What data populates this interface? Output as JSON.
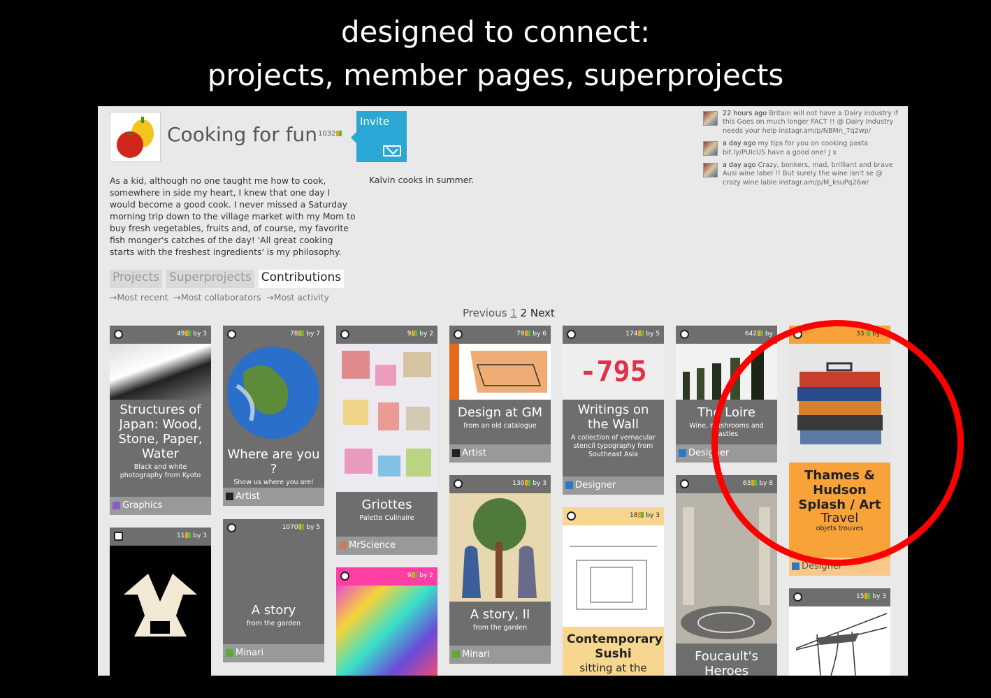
{
  "headline": {
    "line1": "designed to connect:",
    "line2": "projects, member pages, superprojects"
  },
  "project": {
    "title": "Cooking for fun",
    "count": "1032",
    "invite_label": "Invite",
    "description": "As a kid, although no one taught me how to cook, somewhere in side my heart, I knew that one day I would become a good cook. I never missed a Saturday morning trip down to the village market with my Mom to buy fresh vegetables, fruits and, of course, my favorite fish monger's catches of the day! 'All great cooking starts with the freshest ingredients' is my philosophy.",
    "description2": "Kalvin cooks in summer."
  },
  "tweets": [
    {
      "time": "22 hours ago",
      "text": "Britain will not have a Dairy industry if this Goes on much longer FACT !! @ Dairy Industry needs your help instagr.am/p/NBMn_Tq2wp/"
    },
    {
      "time": "a day ago",
      "text": "my tips for you on cooking pasta bit.ly/PUIcUS have a good one! J x"
    },
    {
      "time": "a day ago",
      "text": "Crazy, bonkers, mad, brilliant and brave Ausi wine label !! But surely the wine isn't se @ crazy wine lable instagr.am/p/M_ksuPq26w/"
    }
  ],
  "tabs": [
    "Projects",
    "Superprojects",
    "Contributions"
  ],
  "sorts": [
    "→Most recent",
    "→Most collaborators",
    "→Most activity"
  ],
  "pager": {
    "prev": "Previous",
    "p1": "1",
    "p2": "2",
    "next": "Next"
  },
  "cards": [
    {
      "count": "49",
      "by": "by 3",
      "title": "Structures of Japan: Wood, Stone, Paper, Water",
      "sub": "Black and white photography from Kyoto",
      "foot": "Graphics",
      "color": "#6e6e6e"
    },
    {
      "count": "11",
      "by": "by 3",
      "title": "",
      "sub": "",
      "foot": "",
      "color": "#000000"
    },
    {
      "count": "78",
      "by": "by 7",
      "title": "Where are you ?",
      "sub": "Show us where you are!",
      "foot": "Artist",
      "color": "#6e6e6e"
    },
    {
      "count": "1070",
      "by": "by 5",
      "title": "A story",
      "sub": "from the garden",
      "foot": "Minari",
      "color": "#6e6e6e"
    },
    {
      "count": "9",
      "by": "by 2",
      "title": "Griottes",
      "sub": "Palette Culinaire",
      "foot": "MrScience",
      "color": "#6e6e6e"
    },
    {
      "count": "9",
      "by": "by 2",
      "title": "",
      "sub": "",
      "foot": "",
      "color": "#ff3fa4"
    },
    {
      "count": "79",
      "by": "by 6",
      "title": "Design at GM",
      "sub": "from an old catalogue",
      "foot": "Artist",
      "color": "#6e6e6e"
    },
    {
      "count": "130",
      "by": "by 3",
      "title": "A story, II",
      "sub": "from the garden",
      "foot": "Minari",
      "color": "#6e6e6e"
    },
    {
      "count": "174",
      "by": "by 5",
      "title": "Writings on the Wall",
      "sub": "A collection of vernacular stencil typography from Southeast Asia",
      "foot": "Designer",
      "color": "#6e6e6e"
    },
    {
      "count": "18",
      "by": "by 3",
      "title": "Contemporary Sushi",
      "sub": "sitting at the",
      "foot": "",
      "color": "#f7d68f"
    },
    {
      "count": "642",
      "by": "by",
      "title": "The Loire",
      "sub": "Wine, mushrooms and castles",
      "foot": "Designer",
      "color": "#6e6e6e"
    },
    {
      "count": "63",
      "by": "by 8",
      "title": "Foucault's Heroes",
      "sub": "",
      "foot": "",
      "color": "#6e6e6e"
    },
    {
      "count": "33",
      "by": "by 5",
      "title": "Thames & Hudson Splash / Art",
      "sub2": "Travel",
      "sub": "objets trouves",
      "foot": "Designer",
      "color": "#f7a33a"
    },
    {
      "count": "15",
      "by": "by 3",
      "title": "",
      "sub": "",
      "foot": "",
      "color": "#6e6e6e"
    }
  ],
  "colors": {
    "accent_circle": "#ff0000",
    "invite": "#2aa7d4"
  }
}
